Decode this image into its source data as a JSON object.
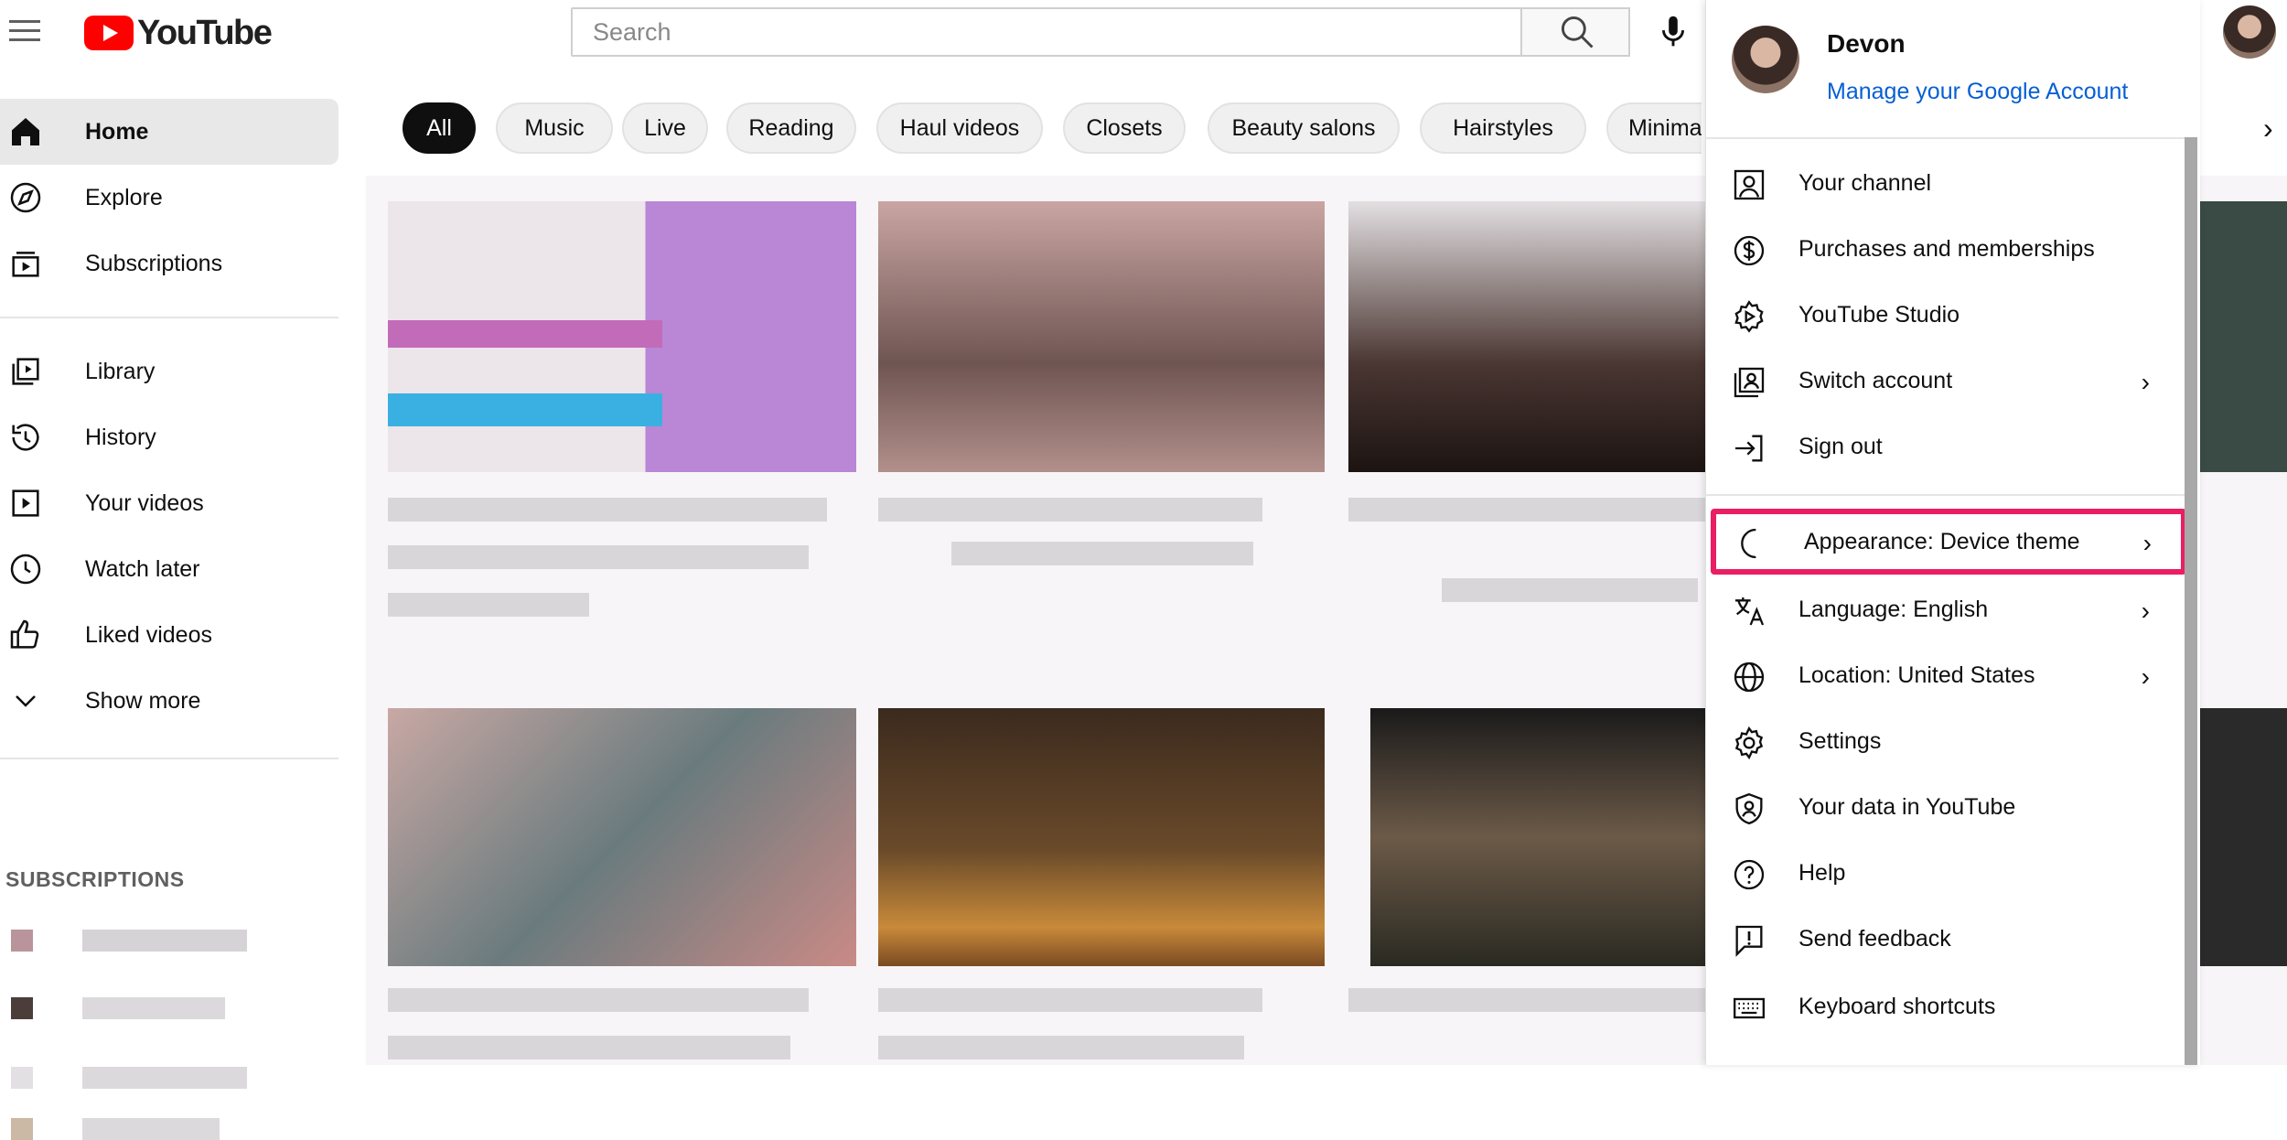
{
  "header": {
    "brand": "YouTube",
    "search": {
      "placeholder": "Search",
      "value": ""
    },
    "icons": [
      "menu-icon",
      "search-icon",
      "mic-icon"
    ]
  },
  "sidebar": {
    "items": [
      {
        "label": "Home",
        "icon": "home-icon",
        "active": true
      },
      {
        "label": "Explore",
        "icon": "compass-icon"
      },
      {
        "label": "Subscriptions",
        "icon": "subscriptions-icon"
      },
      {
        "label": "Library",
        "icon": "library-icon"
      },
      {
        "label": "History",
        "icon": "history-icon"
      },
      {
        "label": "Your videos",
        "icon": "video-icon"
      },
      {
        "label": "Watch later",
        "icon": "clock-icon"
      },
      {
        "label": "Liked videos",
        "icon": "thumb-up-icon"
      },
      {
        "label": "Show more",
        "icon": "chevron-down-icon"
      }
    ],
    "subscriptions_title": "SUBSCRIPTIONS"
  },
  "chips": [
    "All",
    "Music",
    "Live",
    "Reading",
    "Haul videos",
    "Closets",
    "Beauty salons",
    "Hairstyles",
    "Minimalis"
  ],
  "menu": {
    "name": "Devon",
    "manage": "Manage your Google Account",
    "items": [
      {
        "label": "Your channel",
        "icon": "person-icon",
        "chevron": ""
      },
      {
        "label": "Purchases and memberships",
        "icon": "dollar-icon",
        "chevron": ""
      },
      {
        "label": "YouTube Studio",
        "icon": "studio-gear-icon",
        "chevron": ""
      },
      {
        "label": "Switch account",
        "icon": "switch-account-icon",
        "chevron": "›"
      },
      {
        "label": "Sign out",
        "icon": "sign-out-icon",
        "chevron": ""
      },
      {
        "label": "Appearance: Device theme",
        "icon": "moon-icon",
        "chevron": "›"
      },
      {
        "label": "Language: English",
        "icon": "translate-icon",
        "chevron": "›"
      },
      {
        "label": "Location: United States",
        "icon": "globe-icon",
        "chevron": "›"
      },
      {
        "label": "Settings",
        "icon": "gear-icon",
        "chevron": ""
      },
      {
        "label": "Your data in YouTube",
        "icon": "shield-person-icon",
        "chevron": ""
      },
      {
        "label": "Help",
        "icon": "help-icon",
        "chevron": ""
      },
      {
        "label": "Send feedback",
        "icon": "feedback-icon",
        "chevron": ""
      },
      {
        "label": "Keyboard shortcuts",
        "icon": "keyboard-icon",
        "chevron": ""
      }
    ]
  },
  "colors": {
    "brand_red": "#ff0000",
    "link_blue": "#065fd4",
    "highlight": "#e91e63"
  }
}
